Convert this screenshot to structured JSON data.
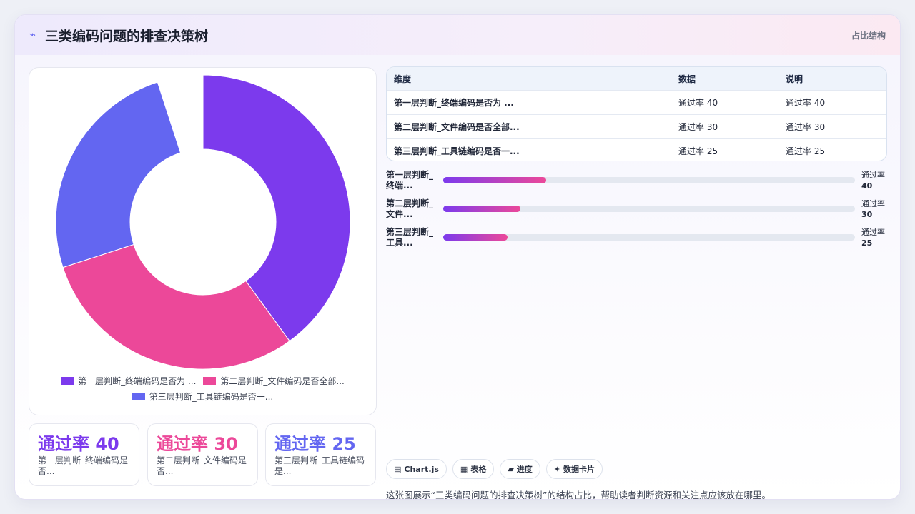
{
  "header": {
    "icon": "lightning-icon",
    "title": "三类编码问题的排查决策树",
    "right_label": "占比结构"
  },
  "chart_data": {
    "type": "pie",
    "donut": true,
    "categories": [
      "第一层判断_终端编码是否为 ...",
      "第二层判断_文件编码是否全部...",
      "第三层判断_工具链编码是否一..."
    ],
    "values": [
      40,
      30,
      25
    ],
    "colors": [
      "#7c3aed",
      "#ec4899",
      "#6366f1"
    ],
    "legend_position": "bottom"
  },
  "stats": [
    {
      "value": "通过率 40",
      "label": "第一层判断_终端编码是否...",
      "color": "#7c3aed"
    },
    {
      "value": "通过率 30",
      "label": "第二层判断_文件编码是否...",
      "color": "#ec4899"
    },
    {
      "value": "通过率 25",
      "label": "第三层判断_工具链编码是...",
      "color": "#6366f1"
    }
  ],
  "table": {
    "headers": [
      "维度",
      "数据",
      "说明"
    ],
    "rows": [
      [
        "第一层判断_终端编码是否为 ...",
        "通过率 40",
        "通过率 40"
      ],
      [
        "第二层判断_文件编码是否全部...",
        "通过率 30",
        "通过率 30"
      ],
      [
        "第三层判断_工具链编码是否一...",
        "通过率 25",
        "通过率 25"
      ]
    ]
  },
  "progress": [
    {
      "label": "第一层判断_终端...",
      "value_prefix": "通过率",
      "value": "40",
      "fill": 0.25
    },
    {
      "label": "第二层判断_文件...",
      "value_prefix": "通过率",
      "value": "30",
      "fill": 0.188
    },
    {
      "label": "第三层判断_工具...",
      "value_prefix": "通过率",
      "value": "25",
      "fill": 0.156
    }
  ],
  "chips": [
    {
      "icon": "chart-icon",
      "glyph": "▤",
      "label": "Chart.js"
    },
    {
      "icon": "table-icon",
      "glyph": "▦",
      "label": "表格"
    },
    {
      "icon": "progress-icon",
      "glyph": "▰",
      "label": "进度"
    },
    {
      "icon": "sparkle-icon",
      "glyph": "✦",
      "label": "数据卡片"
    }
  ],
  "footer_text": "这张图展示“三类编码问题的排查决策树”的结构占比，帮助读者判断资源和关注点应该放在哪里。"
}
